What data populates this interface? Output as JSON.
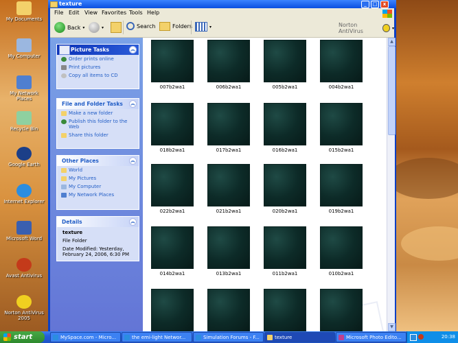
{
  "window": {
    "title": "texture",
    "minimize": "_",
    "maximize": "□",
    "close": "x"
  },
  "menu": [
    "File",
    "Edit",
    "View",
    "Favorites",
    "Tools",
    "Help"
  ],
  "toolbar": {
    "back": "Back",
    "search": "Search",
    "folders": "Folders",
    "norton": "Norton AntiVirus"
  },
  "desktop_icons": [
    "My Documents",
    "My Computer",
    "My Network Places",
    "Recycle Bin",
    "Google Earth",
    "Internet Explorer",
    "Microsoft Word",
    "Avast Antivirus",
    "Norton AntiVirus 2005"
  ],
  "taskpane": {
    "picture_tasks": {
      "title": "Picture Tasks",
      "items": [
        "Order prints online",
        "Print pictures",
        "Copy all items to CD"
      ]
    },
    "file_folder_tasks": {
      "title": "File and Folder Tasks",
      "items": [
        "Make a new folder",
        "Publish this folder to the Web",
        "Share this folder"
      ]
    },
    "other_places": {
      "title": "Other Places",
      "items": [
        "World",
        "My Pictures",
        "My Computer",
        "My Network Places"
      ]
    },
    "details": {
      "title": "Details",
      "name": "texture",
      "type": "File Folder",
      "modified": "Date Modified: Yesterday, February 24, 2006, 6:30 PM"
    }
  },
  "thumbnails": [
    "007b2wa1",
    "006b2wa1",
    "005b2wa1",
    "004b2wa1",
    "018b2wa1",
    "017b2wa1",
    "016b2wa1",
    "015b2wa1",
    "022b2wa1",
    "021b2wa1",
    "020b2wa1",
    "019b2wa1",
    "014b2wa1",
    "013b2wa1",
    "011b2wa1",
    "010b2wa1",
    "",
    "",
    "",
    ""
  ],
  "taskbar": {
    "start": "start",
    "tasks": [
      "MySpace.com - Micro...",
      "the emi-light Networ...",
      "Simulation Forums - F...",
      "texture",
      "Microsoft Photo Edito..."
    ],
    "clock": "20:38"
  },
  "colors": {
    "xp_blue": "#0a4fe0",
    "task_green": "#2d8a2d",
    "pane_blue": "#6375d6",
    "link_blue": "#215dc6"
  }
}
